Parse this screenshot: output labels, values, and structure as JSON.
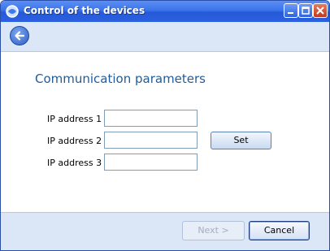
{
  "window": {
    "title": "Control of the devices",
    "controls": [
      "minimize-icon",
      "maximize-icon",
      "close-icon"
    ]
  },
  "navbar": {
    "back_icon": "back-arrow-icon"
  },
  "main": {
    "heading": "Communication parameters",
    "fields": [
      {
        "label": "IP address 1",
        "value": ""
      },
      {
        "label": "IP address 2",
        "value": ""
      },
      {
        "label": "IP address 3",
        "value": ""
      }
    ],
    "set_label": "Set"
  },
  "footer": {
    "next_label": "Next >",
    "next_enabled": false,
    "cancel_label": "Cancel"
  },
  "colors": {
    "titlebar": "#2b60e0",
    "panel": "#dbe6f6",
    "heading": "#1f5c99"
  }
}
